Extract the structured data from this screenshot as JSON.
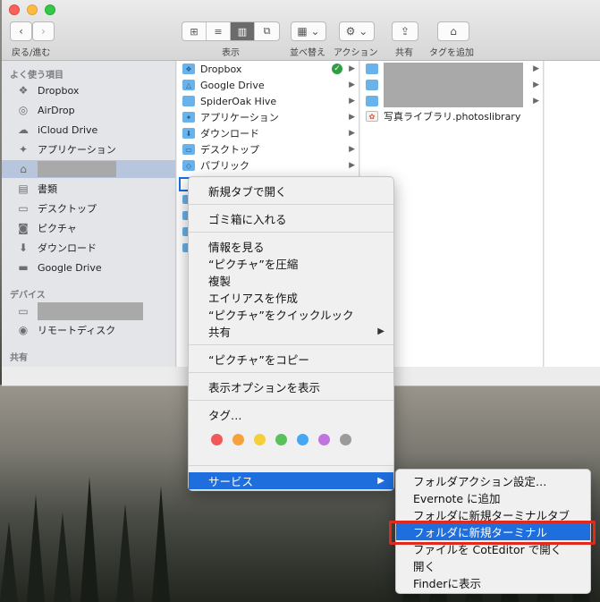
{
  "toolbar": {
    "back_forward_label": "戻る/進む",
    "view_label": "表示",
    "arrange_label": "並べ替え",
    "action_label": "アクション",
    "share_label": "共有",
    "tags_label": "タグを追加"
  },
  "sidebar": {
    "favorites_header": "よく使う項目",
    "favorites": [
      {
        "label": "Dropbox",
        "icon": "dropbox-icon"
      },
      {
        "label": "AirDrop",
        "icon": "airdrop-icon"
      },
      {
        "label": "iCloud Drive",
        "icon": "cloud-icon"
      },
      {
        "label": "アプリケーション",
        "icon": "applications-icon"
      },
      {
        "label": "",
        "icon": "home-icon"
      },
      {
        "label": "書類",
        "icon": "documents-icon"
      },
      {
        "label": "デスクトップ",
        "icon": "desktop-icon"
      },
      {
        "label": "ピクチャ",
        "icon": "camera-icon"
      },
      {
        "label": "ダウンロード",
        "icon": "download-icon"
      },
      {
        "label": "Google Drive",
        "icon": "folder-icon"
      }
    ],
    "devices_header": "デバイス",
    "devices": [
      {
        "label": "",
        "icon": "laptop-icon"
      },
      {
        "label": "リモートディスク",
        "icon": "disc-icon"
      }
    ],
    "shared_header": "共有"
  },
  "column1": {
    "items": [
      "Dropbox",
      "Google Drive",
      "SpiderOak Hive",
      "アプリケーション",
      "ダウンロード",
      "デスクトップ",
      "パブリック"
    ]
  },
  "column2": {
    "library_item": "写真ライブラリ.photoslibrary"
  },
  "context_menu": {
    "items": {
      "new_tab": "新規タブで開く",
      "trash": "ゴミ箱に入れる",
      "get_info": "情報を見る",
      "compress": "“ピクチャ”を圧縮",
      "duplicate": "複製",
      "make_alias": "エイリアスを作成",
      "quick_look": "“ピクチャ”をクイックルック",
      "share": "共有",
      "copy": "“ピクチャ”をコピー",
      "view_options": "表示オプションを表示",
      "tags": "タグ…",
      "services": "サービス"
    },
    "tag_colors": [
      "#f25757",
      "#f7a13c",
      "#f5cf3a",
      "#5ac15a",
      "#47a7f2",
      "#c074e0",
      "#9b9b9b"
    ]
  },
  "services_submenu": {
    "items": [
      "フォルダアクション設定…",
      "Evernote に追加",
      "フォルダに新規ターミナルタブ",
      "フォルダに新規ターミナル",
      "ファイルを CotEditor で開く",
      "開く",
      "Finderに表示"
    ]
  },
  "colors": {
    "highlight": "#1f6ede",
    "annotation_box": "#e12a1e"
  }
}
